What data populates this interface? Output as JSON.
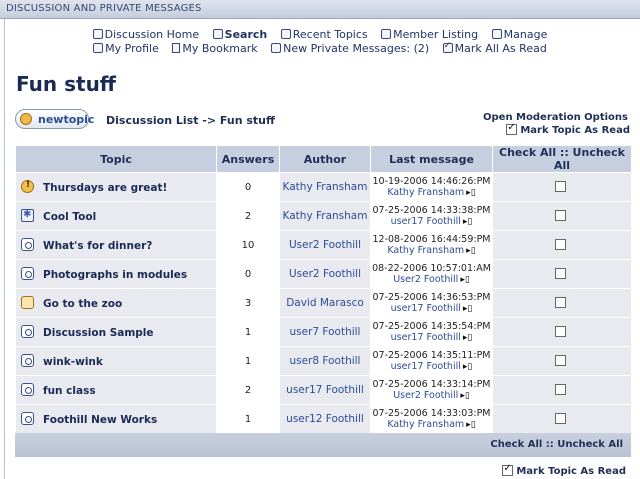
{
  "window": {
    "title": "DISCUSSION AND PRIVATE MESSAGES"
  },
  "nav": {
    "row1": [
      {
        "label": "Discussion Home",
        "icon": "home-icon",
        "bold": false
      },
      {
        "label": "Search",
        "icon": "search-icon",
        "bold": true
      },
      {
        "label": "Recent Topics",
        "icon": "recent-topics-icon",
        "bold": false
      },
      {
        "label": "Member Listing",
        "icon": "members-icon",
        "bold": false
      },
      {
        "label": "Manage",
        "icon": "manage-icon",
        "bold": false
      }
    ],
    "row2": [
      {
        "label": "My Profile",
        "icon": "profile-icon",
        "bold": false
      },
      {
        "label": "My Bookmark",
        "icon": "bookmark-icon",
        "bold": false
      },
      {
        "label": "New Private Messages: (2)",
        "icon": "private-messages-icon",
        "bold": false
      },
      {
        "label": "Mark All As Read",
        "icon": "checkbox-icon",
        "bold": false
      }
    ]
  },
  "page": {
    "title": "Fun stuff",
    "new_topic_label": "newtopic",
    "breadcrumb": "Discussion List -> Fun stuff",
    "moderation_label": "Open Moderation Options",
    "mark_topic_read_label": "Mark Topic As Read"
  },
  "table": {
    "headers": {
      "topic": "Topic",
      "answers": "Answers",
      "author": "Author",
      "last": "Last message",
      "check": "Check All :: Uncheck All"
    },
    "rows": [
      {
        "icon": "alert-icon",
        "topic": "Thursdays are great!",
        "answers": "0",
        "author": "Kathy Fransham",
        "last_date": "10-19-2006 14:46:26:PM",
        "last_user": "Kathy Fransham"
      },
      {
        "icon": "tool-icon",
        "topic": "Cool Tool",
        "answers": "2",
        "author": "Kathy Fransham",
        "last_date": "07-25-2006 14:33:38:PM",
        "last_user": "user17 Foothill"
      },
      {
        "icon": "topic-icon",
        "topic": "What's for dinner?",
        "answers": "10",
        "author": "User2 Foothill",
        "last_date": "12-08-2006 16:44:59:PM",
        "last_user": "Kathy Fransham"
      },
      {
        "icon": "topic-icon",
        "topic": "Photographs in modules",
        "answers": "0",
        "author": "User2 Foothill",
        "last_date": "08-22-2006 10:57:01:AM",
        "last_user": "User2 Foothill"
      },
      {
        "icon": "locked-topic-icon",
        "topic": "Go to the zoo",
        "answers": "3",
        "author": "David Marasco",
        "last_date": "07-25-2006 14:36:53:PM",
        "last_user": "user17 Foothill"
      },
      {
        "icon": "topic-icon",
        "topic": "Discussion Sample",
        "answers": "1",
        "author": "user7 Foothill",
        "last_date": "07-25-2006 14:35:54:PM",
        "last_user": "user17 Foothill"
      },
      {
        "icon": "topic-icon",
        "topic": "wink-wink",
        "answers": "1",
        "author": "user8 Foothill",
        "last_date": "07-25-2006 14:35:11:PM",
        "last_user": "user17 Foothill"
      },
      {
        "icon": "topic-icon",
        "topic": "fun class",
        "answers": "2",
        "author": "user17 Foothill",
        "last_date": "07-25-2006 14:33:14:PM",
        "last_user": "User2 Foothill"
      },
      {
        "icon": "topic-icon",
        "topic": "Foothill New Works",
        "answers": "1",
        "author": "user12 Foothill",
        "last_date": "07-25-2006 14:33:03:PM",
        "last_user": "Kathy Fransham"
      }
    ]
  },
  "footer": {
    "check_label": "Check All :: Uncheck All",
    "mark_topic_read_label": "Mark Topic As Read"
  }
}
